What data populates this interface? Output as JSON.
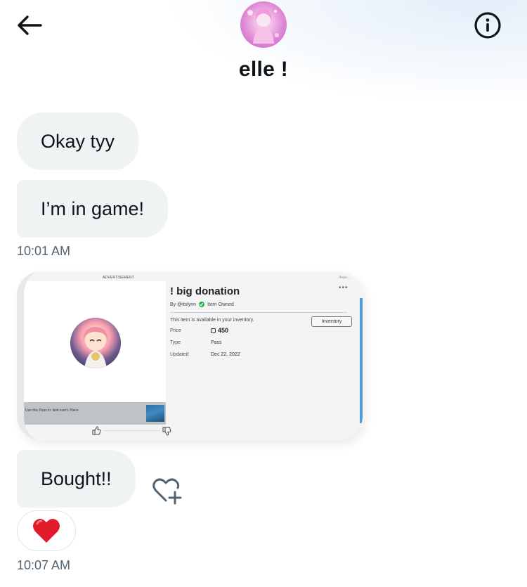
{
  "header": {
    "contact_name": "elle !",
    "back_icon": "arrow-left-icon",
    "info_icon": "info-circle-icon"
  },
  "messages": [
    {
      "text": "Okay tyy"
    },
    {
      "text": "I’m in game!"
    },
    {
      "timestamp": "10:01 AM"
    },
    {
      "text": "Bought!!"
    },
    {
      "reaction": "red-heart-emoji",
      "timestamp": "10:07 AM"
    }
  ],
  "media_card": {
    "ad_label": "ADVERTISEMENT",
    "report_label": "Repo...",
    "title": "! big donation",
    "by": "By @itslynn",
    "owned": "Item Owned",
    "available": "This item is available in your inventory.",
    "inventory_button": "Inventory",
    "price_label": "Price",
    "price_value": "450",
    "type_label": "Type",
    "type_value": "Pass",
    "updated_label": "Updated",
    "updated_value": "Dec 22, 2022",
    "use_pass": "Use this Pass in: iiimLxser's Place"
  },
  "colors": {
    "bubble": "#eff3f4",
    "timestamp": "#536471",
    "heart": "#e0245e"
  }
}
